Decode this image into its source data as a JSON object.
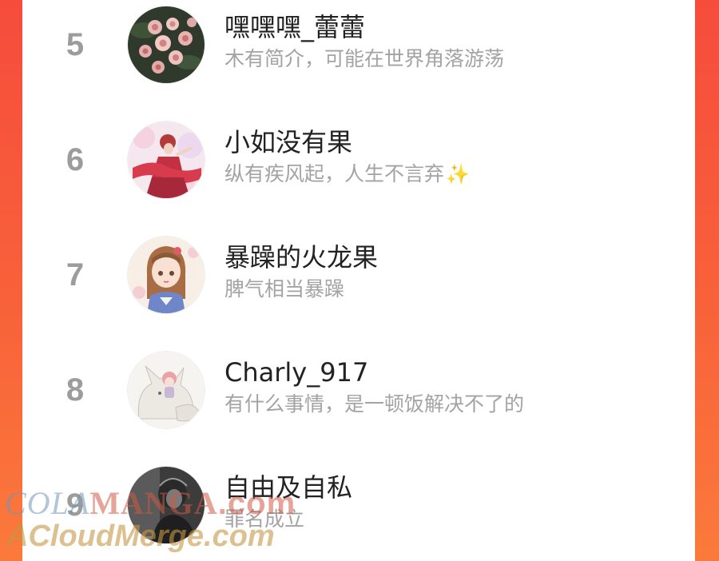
{
  "rankings": [
    {
      "rank": "5",
      "name": "嘿嘿嘿_蕾蕾",
      "bio": "木有简介，可能在世界角落游荡",
      "avatar_icon": "roses-avatar"
    },
    {
      "rank": "6",
      "name": "小如没有果",
      "bio": "纵有疾风起，人生不言弃",
      "bio_emoji": "✨",
      "avatar_icon": "red-dress-figure-avatar"
    },
    {
      "rank": "7",
      "name": "暴躁的火龙果",
      "bio": "脾气相当暴躁",
      "avatar_icon": "anime-girl-avatar"
    },
    {
      "rank": "8",
      "name": "Charly_917",
      "bio": "有什么事情，是一顿饭解决不了的",
      "avatar_icon": "fox-and-girl-avatar"
    },
    {
      "rank": "9",
      "name": "自由及自私",
      "bio": "罪名成立",
      "avatar_icon": "dark-portrait-avatar"
    }
  ],
  "watermark": {
    "line1_a": "COLA",
    "line1_b": "MANGA",
    "line1_c": ".com",
    "line2": "ACloudMerge.com"
  },
  "colors": {
    "side_gradient_top": "#f64c3c",
    "side_gradient_bottom": "#fb7a3b",
    "rank_number": "#9c9c9c",
    "name_text": "#222222",
    "bio_text": "#a3a3a3"
  }
}
